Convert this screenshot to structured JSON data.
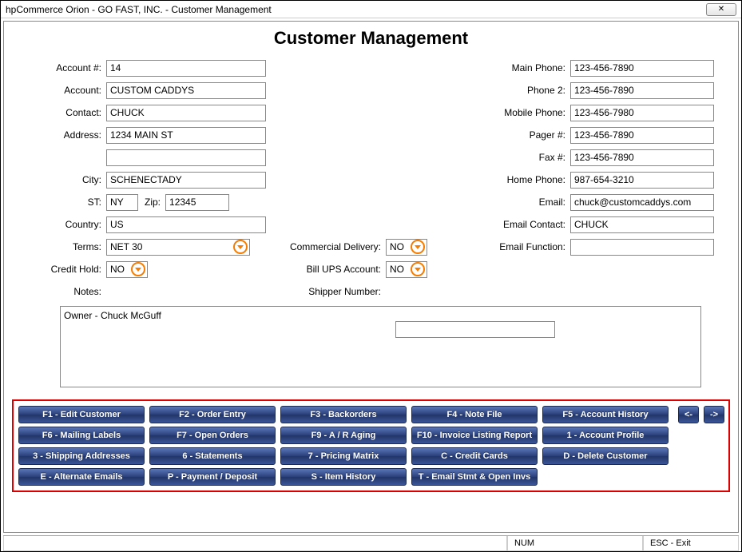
{
  "window": {
    "title": "hpCommerce Orion - GO FAST, INC. - Customer Management",
    "close_glyph": "✕"
  },
  "page_title": "Customer Management",
  "labels": {
    "account_no": "Account #:",
    "account": "Account:",
    "contact": "Contact:",
    "address": "Address:",
    "city": "City:",
    "st": "ST:",
    "zip": "Zip:",
    "country": "Country:",
    "terms": "Terms:",
    "credit_hold": "Credit Hold:",
    "notes": "Notes:",
    "commercial_delivery": "Commercial Delivery:",
    "bill_ups": "Bill UPS Account:",
    "shipper_number": "Shipper Number:",
    "main_phone": "Main Phone:",
    "phone2": "Phone 2:",
    "mobile_phone": "Mobile Phone:",
    "pager": "Pager #:",
    "fax": "Fax #:",
    "home_phone": "Home Phone:",
    "email": "Email:",
    "email_contact": "Email Contact:",
    "email_function": "Email Function:"
  },
  "fields": {
    "account_no": "14",
    "account": "CUSTOM CADDYS",
    "contact": "CHUCK",
    "address1": "1234 MAIN ST",
    "address2": "",
    "city": "SCHENECTADY",
    "st": "NY",
    "zip": "12345",
    "country": "US",
    "terms": "NET 30",
    "credit_hold": "NO",
    "commercial_delivery": "NO",
    "bill_ups": "NO",
    "shipper_number": "",
    "main_phone": "123-456-7890",
    "phone2": "123-456-7890",
    "mobile_phone": "123-456-7980",
    "pager": "123-456-7890",
    "fax": "123-456-7890",
    "home_phone": "987-654-3210",
    "email": "chuck@customcaddys.com",
    "email_contact": "CHUCK",
    "email_function": "",
    "notes": "Owner - Chuck McGuff"
  },
  "buttons": {
    "row1": [
      "F1 - Edit Customer",
      "F2 - Order Entry",
      "F3 - Backorders",
      "F4 - Note File",
      "F5 - Account History"
    ],
    "row2": [
      "F6 - Mailing Labels",
      "F7 - Open Orders",
      "F9 - A / R Aging",
      "F10 - Invoice Listing Report",
      "1 - Account Profile"
    ],
    "row3": [
      "3 - Shipping Addresses",
      "6 - Statements",
      "7 - Pricing Matrix",
      "C - Credit Cards",
      "D - Delete Customer"
    ],
    "row4": [
      "E - Alternate Emails",
      "P - Payment / Deposit",
      "S - Item History",
      "T - Email Stmt & Open Invs"
    ],
    "nav_prev": "<-",
    "nav_next": "->"
  },
  "status": {
    "num": "NUM",
    "esc": "ESC - Exit"
  }
}
